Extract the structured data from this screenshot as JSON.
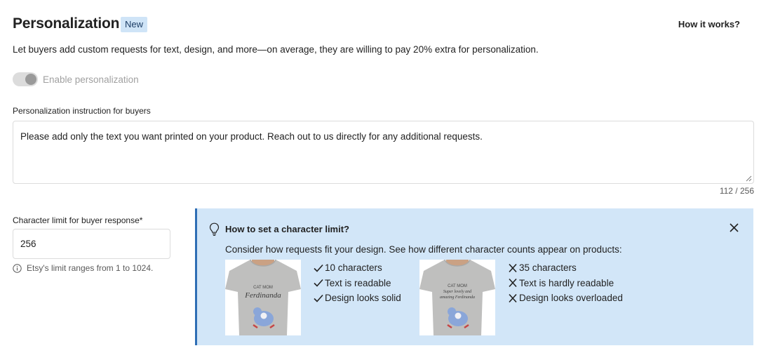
{
  "header": {
    "title": "Personalization",
    "badge": "New",
    "how_it_works": "How it works?"
  },
  "subtitle": "Let buyers add custom requests for text, design, and more—on average, they are willing to pay 20% extra for personalization.",
  "toggle": {
    "label": "Enable personalization",
    "state": "on",
    "disabled": true
  },
  "instruction": {
    "label": "Personalization instruction for buyers",
    "value": "Please add only the text you want printed on your product. Reach out to us directly for any additional requests.",
    "counter": "112 / 256"
  },
  "char_limit": {
    "label": "Character limit for buyer response",
    "required_mark": "*",
    "value": "256",
    "hint": "Etsy's limit ranges from 1 to 1024."
  },
  "tip": {
    "title": "How to set a character limit?",
    "description": "Consider how requests fit your design. See how different character counts appear on products:",
    "good_example": {
      "shirt_text_1": "CAT MOM",
      "shirt_text_2": "Ferdinanda",
      "items": [
        "10 characters",
        "Text is readable",
        "Design looks solid"
      ],
      "icon": "check-icon"
    },
    "bad_example": {
      "shirt_text_1": "CAT MOM",
      "shirt_text_2": "Super lovely and",
      "shirt_text_3": "amazing Ferdinanda",
      "items": [
        "35 characters",
        "Text is hardly readable",
        "Design looks overloaded"
      ],
      "icon": "x-icon"
    }
  },
  "colors": {
    "tip_background": "#d2e6f8",
    "tip_border": "#2f6eb5",
    "badge_background": "#cfe4f7",
    "shirt": "#bfbfbe"
  }
}
